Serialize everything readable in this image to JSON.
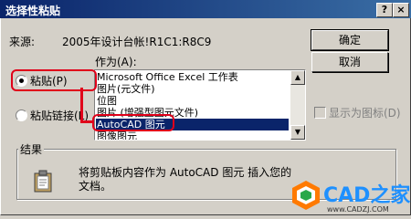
{
  "window": {
    "title": "选择性粘贴",
    "help_label": "?",
    "close_label": "×"
  },
  "source": {
    "label": "来源:",
    "value": "2005年设计台帐!R1C1:R8C9"
  },
  "buttons": {
    "ok": "确定",
    "cancel": "取消"
  },
  "options": {
    "paste": "粘贴(P)",
    "paste_link": "粘贴链接(L)",
    "paste_selected": true
  },
  "as_label": "作为(A):",
  "list_items": [
    "Microsoft Office Excel 工作表",
    "图片(元文件)",
    "位图",
    "图片 (增强型图元文件)",
    "AutoCAD 图元",
    "图像图元"
  ],
  "list_selected_index": 4,
  "display_icon": {
    "label": "显示为图标(D)",
    "checked": false
  },
  "result": {
    "title": "结果",
    "text_line1": "将剪贴板内容作为 AutoCAD 图元 插入您的",
    "text_line2": "文档。"
  },
  "watermark": {
    "brand": "CAD之家",
    "url": "www.CADZJ.COM"
  },
  "colors": {
    "titlebar": "#0a246a",
    "face": "#d4d0c8",
    "selection": "#0a246a",
    "annotation": "#e0001a",
    "brand": "#1e90ff"
  }
}
